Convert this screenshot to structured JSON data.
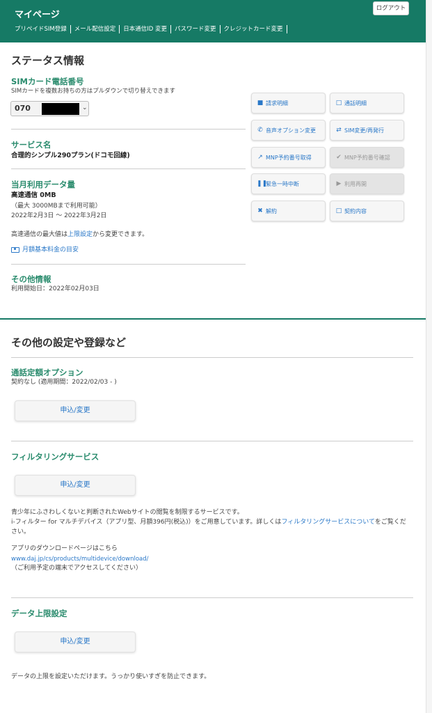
{
  "header": {
    "title": "マイページ",
    "logout": "ログアウト",
    "nav": [
      "プリペイドSIM登録",
      "メール配信設定",
      "日本通信ID 変更",
      "パスワード変更",
      "クレジットカード変更"
    ]
  },
  "status": {
    "heading": "ステータス情報",
    "sim": {
      "title": "SIMカード電話番号",
      "note": "SIMカードを複数お持ちの方はプルダウンで切り替えできます",
      "selected_prefix": "070"
    },
    "service": {
      "title": "サービス名",
      "value": "合理的シンプル290プラン(ドコモ回線)"
    },
    "data_usage": {
      "title": "当月利用データ量",
      "value": "高速通信 0MB",
      "limit": "（最大 3000MBまで利用可能）",
      "period": "2022年2月3日 ～ 2022年3月2日",
      "note_pre": "高速通信の最大値は",
      "note_link": "上限設定",
      "note_post": "から変更できます。",
      "fee_link": "月額基本料金の目安"
    },
    "other": {
      "title": "その他情報",
      "start": "利用開始日：2022年02月03日"
    }
  },
  "actions": [
    {
      "label": "請求明細",
      "icon": "■"
    },
    {
      "label": "通話明細",
      "icon": "□"
    },
    {
      "label": "音声オプション変更",
      "icon": "✆"
    },
    {
      "label": "SIM変更/再発行",
      "icon": "⇄"
    },
    {
      "label": "MNP予約番号取得",
      "icon": "↗"
    },
    {
      "label": "MNP予約番号確認",
      "icon": "✔"
    },
    {
      "label": "緊急一時中断",
      "icon": "❚❚"
    },
    {
      "label": "利用再開",
      "icon": "▶"
    },
    {
      "label": "解約",
      "icon": "✖"
    },
    {
      "label": "契約内容",
      "icon": "□"
    }
  ],
  "settings": {
    "heading": "その他の設定や登録など",
    "call": {
      "title": "通話定額オプション",
      "status": "契約なし (適用期間：2022/02/03 - )",
      "button": "申込/変更"
    },
    "filter": {
      "title": "フィルタリングサービス",
      "button": "申込/変更",
      "desc1": "青少年にふさわしくないと判断されたWebサイトの閲覧を制限するサービスです。",
      "desc2_pre": "i-フィルター for マルチデバイス（アプリ型、月額396円(税込)）をご用意しています。詳しくは",
      "desc2_link": "フィルタリングサービスについて",
      "desc2_post": "をご覧くだ",
      "desc3": "さい。",
      "dl_label": "アプリのダウンロードページはこちら",
      "dl_url": "www.daj.jp/cs/products/multidevice/download/",
      "dl_note": "（ご利用予定の端末でアクセスしてください）"
    },
    "data_limit": {
      "title": "データ上限設定",
      "button": "申込/変更",
      "desc": "データの上限を設定いただけます。うっかり使いすぎを防止できます。"
    }
  }
}
